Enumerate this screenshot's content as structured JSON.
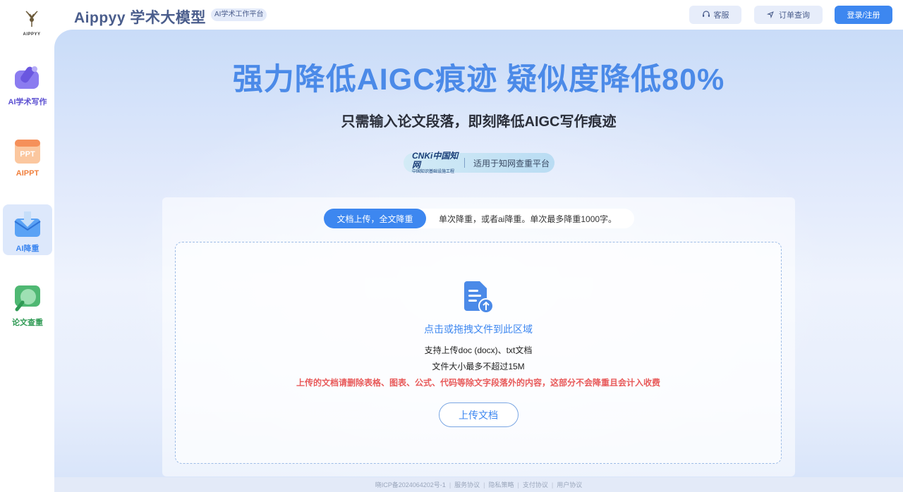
{
  "logo": {
    "text": "AIPPYY"
  },
  "sidebar": {
    "items": [
      {
        "label": "AI学术写作",
        "color": "#5b4fd1"
      },
      {
        "label": "AIPPT",
        "color": "#f07f3c"
      },
      {
        "label": "AI降重",
        "color": "#3d87f0",
        "active": true
      },
      {
        "label": "论文查重",
        "color": "#2f9a54"
      }
    ]
  },
  "header": {
    "brand": "Aippyy 学术大模型",
    "badge": "AI学术工作平台",
    "service_label": "客服",
    "order_label": "订单查询",
    "login_label": "登录/注册"
  },
  "main": {
    "headline": "强力降低AIGC痕迹 疑似度降低80%",
    "subline": "只需输入论文段落，即刻降低AIGC写作痕迹",
    "cnki": {
      "logo_big": "CNKi中国知网",
      "logo_small": "中国知识基础设施工程",
      "text": "适用于知网查重平台"
    }
  },
  "upload": {
    "tab_active": "文档上传，全文降重",
    "tab_desc": "单次降重，或者ai降重。单次最多降重1000字。",
    "title": "点击或拖拽文件到此区域",
    "line1": "支持上传doc (docx)、txt文档",
    "line2": "文件大小最多不超过15M",
    "warning": "上传的文档请删除表格、图表、公式、代码等除文字段落外的内容，这部分不会降重且会计入收费",
    "button": "上传文档"
  },
  "footer": {
    "icp": "晓ICP备2024064202号-1",
    "links": [
      "服务协议",
      "隐私策略",
      "支付协议",
      "用户协议"
    ]
  },
  "colors": {
    "accent": "#3d87f0",
    "warning": "#e85a5a",
    "headline": "#4b8ae8"
  }
}
